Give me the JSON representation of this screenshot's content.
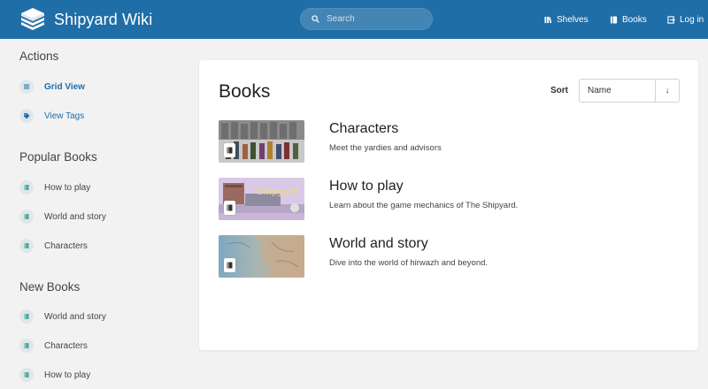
{
  "header": {
    "brand_name": "Shipyard Wiki",
    "search_placeholder": "Search",
    "nav": [
      {
        "label": "Shelves",
        "icon": "shelves-icon"
      },
      {
        "label": "Books",
        "icon": "books-icon"
      },
      {
        "label": "Log in",
        "icon": "login-icon"
      }
    ]
  },
  "sidebar": {
    "actions_heading": "Actions",
    "actions": [
      {
        "label": "Grid View",
        "icon": "grid-icon"
      },
      {
        "label": "View Tags",
        "icon": "tag-icon"
      }
    ],
    "popular_heading": "Popular Books",
    "popular": [
      {
        "label": "How to play"
      },
      {
        "label": "World and story"
      },
      {
        "label": "Characters"
      }
    ],
    "new_heading": "New Books",
    "new": [
      {
        "label": "World and story"
      },
      {
        "label": "Characters"
      },
      {
        "label": "How to play"
      }
    ]
  },
  "main": {
    "title": "Books",
    "sort_label": "Sort",
    "sort_value": "Name",
    "sort_direction": "↓",
    "books": [
      {
        "title": "Characters",
        "description": "Meet the yardies and advisors"
      },
      {
        "title": "How to play",
        "description": "Learn about the game mechanics of The Shipyard."
      },
      {
        "title": "World and story",
        "description": "Dive into the world of hirwazh and beyond."
      }
    ]
  },
  "colors": {
    "header_bg": "#206ea7",
    "accent": "#206ea7",
    "page_bg": "#f2f2f2"
  }
}
